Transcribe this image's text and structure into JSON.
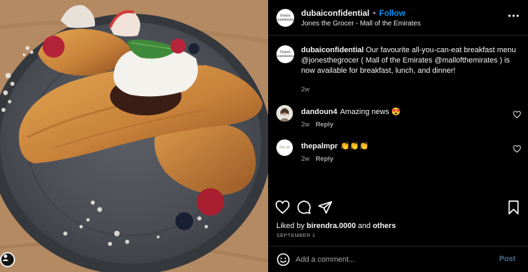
{
  "photo": {
    "alt_icon": "food-photo"
  },
  "header": {
    "avatar_text": "Dubai Confidential",
    "username": "dubaiconfidential",
    "separator": "•",
    "follow_label": "Follow",
    "location": "Jones the Grocer - Mall of the Emirates",
    "more_icon": "more-dots-icon"
  },
  "caption": {
    "username": "dubaiconfidential",
    "text": "Our favourite all-you-can-eat breakfast menu @jonesthegrocer ( Mall of the Emirates @mallofthemirates ) is now available for breakfast, lunch, and dinner!",
    "time": "2w"
  },
  "comments": [
    {
      "username": "dandoun4",
      "text": "Amazing news 😍",
      "time": "2w",
      "reply_label": "Reply"
    },
    {
      "username": "thepalmpr",
      "avatar_text": "PALM",
      "text": "👏👏👏",
      "time": "2w",
      "reply_label": "Reply"
    }
  ],
  "likes": {
    "prefix": "Liked by",
    "user": "birendra.0000",
    "middle": "and",
    "others": "others"
  },
  "date": "SEPTEMBER 1",
  "add_comment": {
    "placeholder": "Add a comment...",
    "post_label": "Post"
  }
}
